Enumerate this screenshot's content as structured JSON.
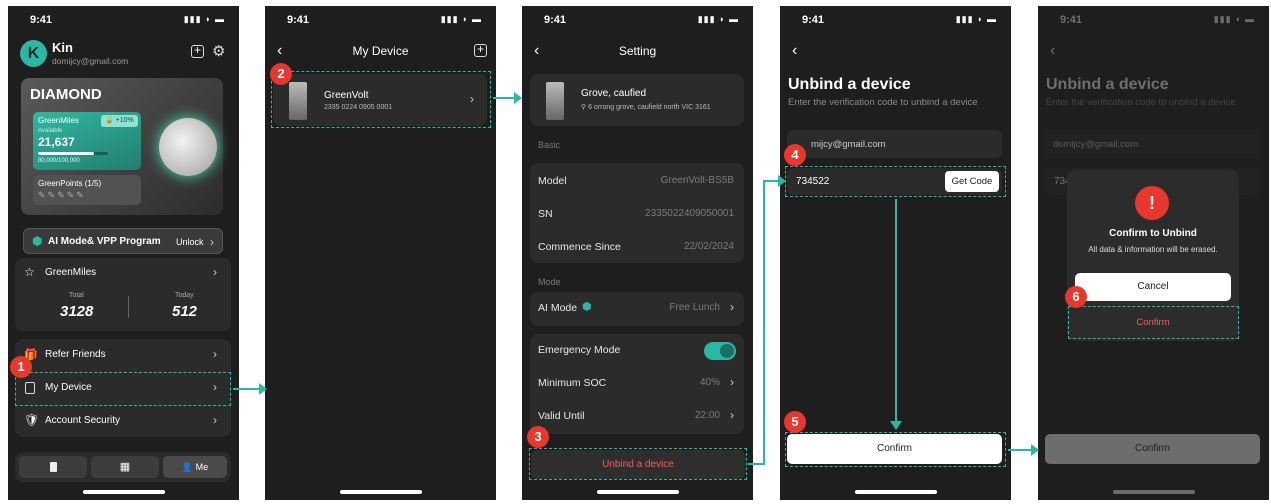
{
  "status": {
    "time": "9:41",
    "signal": "▮▮▮ ◗ ▬"
  },
  "screen1": {
    "avatar_letter": "K",
    "user_name": "Kin",
    "user_email": "domijcy@gmail.com",
    "tier": "DIAMOND",
    "greenmiles_title": "GreenMiles",
    "greenmiles_badge": "+10%",
    "available_label": "Available",
    "available_value": "21,637",
    "progress_text": "80,000/100,000",
    "progress_fraction": 0.8,
    "greenpoints_title": "GreenPoints (1/5)",
    "program_title": "AI Mode& VPP Program",
    "program_action": "Unlock",
    "gm_row_label": "GreenMiles",
    "total_label": "Total",
    "total_value": "3128",
    "today_label": "Today",
    "today_value": "512",
    "menu": [
      "Refer Friends",
      "My Device",
      "Account Security"
    ],
    "tabs": {
      "me": "Me"
    }
  },
  "screen2": {
    "title": "My Device",
    "device_name": "GreenVolt",
    "device_serial": "2335 0224 0905 0001"
  },
  "screen3": {
    "title": "Setting",
    "device_name": "Grove, caufied",
    "device_address": "6 orrong grove, caufield north VIC 3161",
    "basic_label": "Basic",
    "model_label": "Model",
    "model_value": "GreenVolt-BS5B",
    "sn_label": "SN",
    "sn_value": "2335022409050001",
    "commence_label": "Commence Since",
    "commence_value": "22/02/2024",
    "mode_label": "Mode",
    "ai_mode_label": "AI Mode",
    "ai_mode_value": "Free Lunch",
    "emergency_label": "Emergency Mode",
    "min_soc_label": "Minimum SOC",
    "min_soc_value": "40%",
    "valid_until_label": "Valid Until",
    "valid_until_value": "22:00",
    "unbind_button": "Unbind a device"
  },
  "screen4": {
    "title": "Unbind a device",
    "subtitle": "Enter the verification code to unbind a device",
    "email_value": "mijcy@gmail.com",
    "code_value": "734522",
    "get_code_button": "Get Code",
    "confirm_button": "Confirm"
  },
  "screen5": {
    "title": "Unbind a device",
    "subtitle": "Enter the verification code to unbind a device",
    "email_value": "domijcy@gmail.com",
    "code_value": "734",
    "dialog_title": "Confirm to Unbind",
    "dialog_message": "All data & information will be erased.",
    "cancel_button": "Cancel",
    "dialog_confirm": "Confirm",
    "confirm_button": "Confirm"
  },
  "steps": [
    "1",
    "2",
    "3",
    "4",
    "5",
    "6"
  ],
  "colors": {
    "accent": "#2ab7a4",
    "danger": "#e8372c",
    "background": "#1e1e1e",
    "card": "#2b2b2b"
  }
}
